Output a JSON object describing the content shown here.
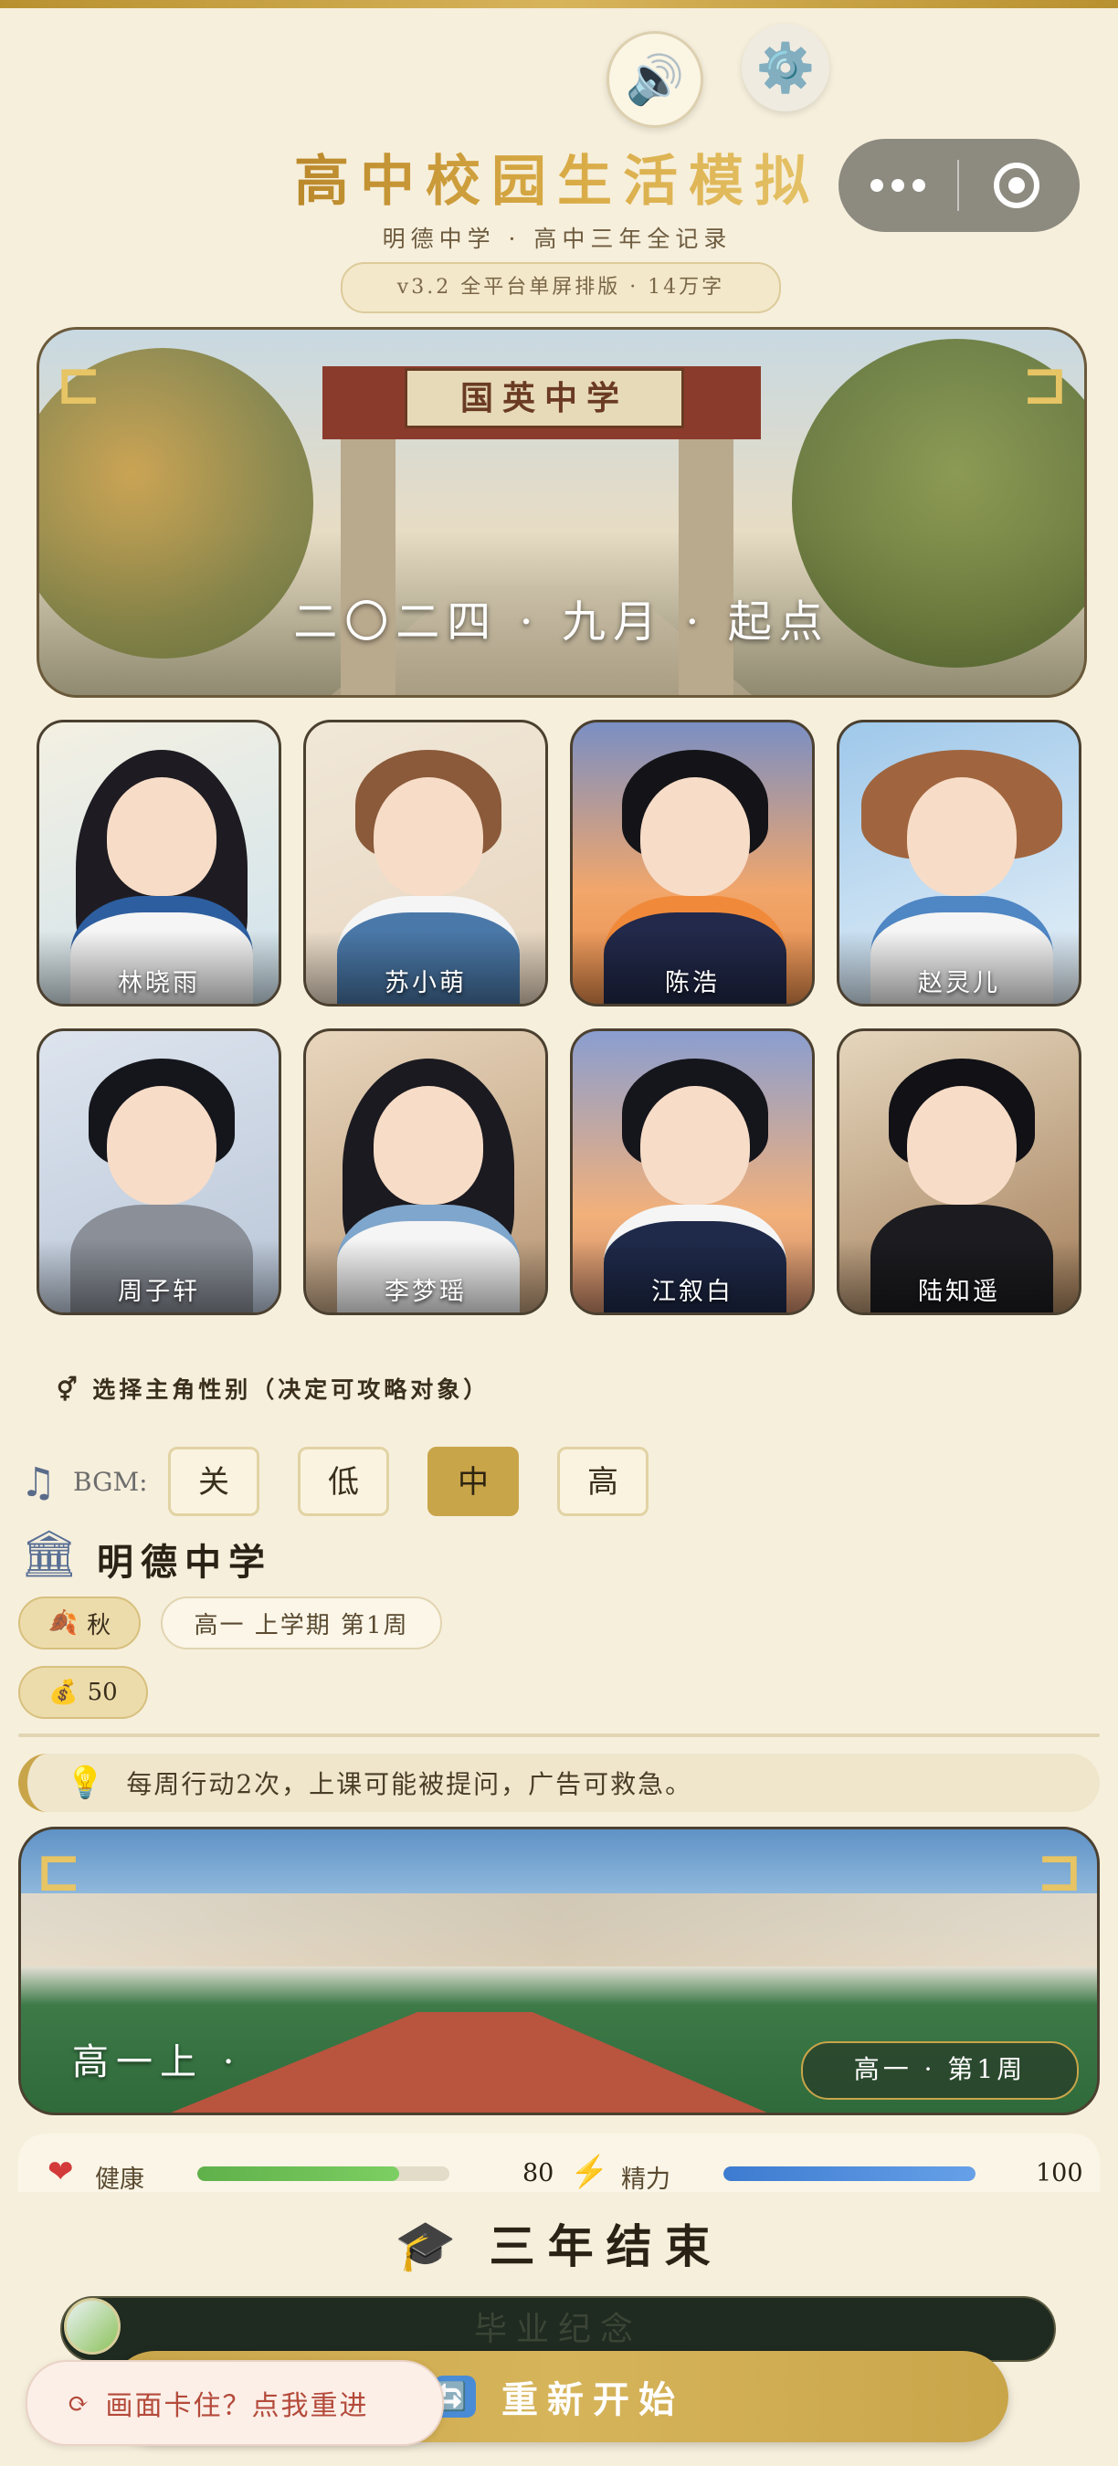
{
  "header": {
    "sound_icon": "speaker-icon",
    "settings_icon": "gear-icon",
    "title": "高中校园生活模拟",
    "subtitle": "明德中学 · 高中三年全记录",
    "version": "v3.2 全平台单屏排版 · 14万字"
  },
  "hero": {
    "sign": "国英中学",
    "caption": "二〇二四 · 九月 · 起点"
  },
  "characters": [
    {
      "name": "林晓雨"
    },
    {
      "name": "苏小萌"
    },
    {
      "name": "陈浩"
    },
    {
      "name": "赵灵儿"
    },
    {
      "name": "周子轩"
    },
    {
      "name": "李梦瑶"
    },
    {
      "name": "江叙白"
    },
    {
      "name": "陆知遥"
    }
  ],
  "gender_prompt": "⚥ 选择主角性别（决定可攻略对象）",
  "bgm": {
    "label": "BGM:",
    "options": [
      "关",
      "低",
      "中",
      "高"
    ],
    "selected": "中"
  },
  "school": {
    "name": "明德中学"
  },
  "status": {
    "season": "秋",
    "term": "高一 上学期 第1周",
    "money": "50"
  },
  "tip": "每周行动2次，上课可能被提问，广告可救急。",
  "scene": {
    "left_text": "高一上 ·",
    "week": "高一 · 第1周"
  },
  "stats": {
    "health_label": "健康",
    "health_value": "80",
    "health_pct": 80,
    "energy_label": "精力",
    "energy_value": "100",
    "energy_pct": 100
  },
  "ending": {
    "title": "三年结束",
    "memorial": "毕业纪念",
    "restart": "重新开始",
    "stuck": "画面卡住？点我重进"
  },
  "colors": {
    "gold": "#c9a54a",
    "background": "#f6efdc",
    "health": "#6cc158",
    "energy": "#4a8bd6"
  }
}
